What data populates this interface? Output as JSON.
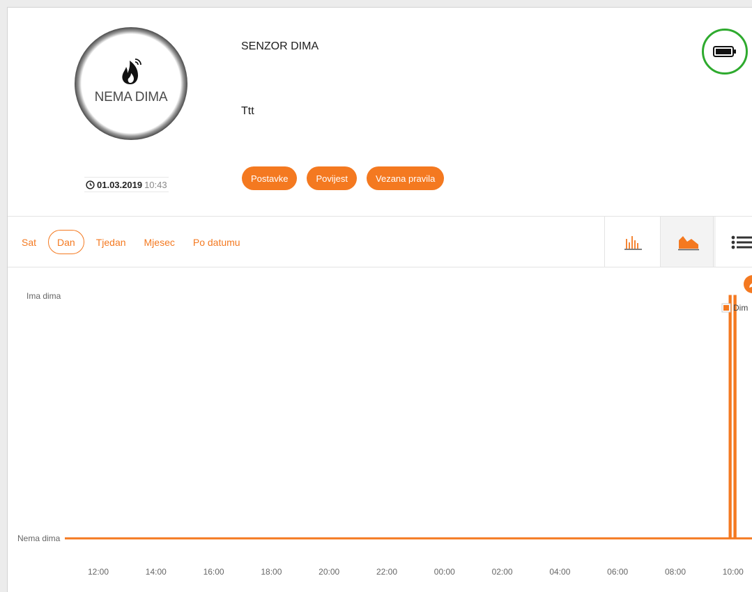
{
  "device": {
    "status_text": "NEMA DIMA",
    "name": "SENZOR DIMA",
    "description": "Ttt",
    "date": "01.03.2019",
    "time": "10:43",
    "battery_status": "full",
    "battery_color": "#2eaa2e"
  },
  "actions": {
    "settings": "Postavke",
    "history": "Povijest",
    "rules": "Vezana pravila"
  },
  "range_tabs": [
    {
      "label": "Sat",
      "active": false
    },
    {
      "label": "Dan",
      "active": true
    },
    {
      "label": "Tjedan",
      "active": false
    },
    {
      "label": "Mjesec",
      "active": false
    },
    {
      "label": "Po datumu",
      "active": false
    }
  ],
  "view_modes": {
    "options": [
      "bar-chart-icon",
      "area-chart-icon",
      "list-icon"
    ],
    "selected": "area-chart-icon"
  },
  "theme": {
    "accent": "#f47920",
    "axis_text": "#666666"
  },
  "chart_data": {
    "type": "area",
    "y_categories": [
      "Nema dima",
      "Ima dima"
    ],
    "x_ticks": [
      "12:00",
      "14:00",
      "16:00",
      "18:00",
      "20:00",
      "22:00",
      "00:00",
      "02:00",
      "04:00",
      "06:00",
      "08:00",
      "10:00"
    ],
    "series": [
      {
        "name": "Dim",
        "color": "#f47920",
        "points": [
          {
            "x": "10:48",
            "y": 0
          },
          {
            "x": "11:00",
            "y": 0
          },
          {
            "x": "09:53",
            "y": 0
          },
          {
            "x": "09:53",
            "y": 1
          },
          {
            "x": "09:55",
            "y": 1
          },
          {
            "x": "09:55",
            "y": 0
          },
          {
            "x": "10:03",
            "y": 0
          },
          {
            "x": "10:03",
            "y": 1
          },
          {
            "x": "10:05",
            "y": 1
          },
          {
            "x": "10:05",
            "y": 0
          },
          {
            "x": "10:43",
            "y": 0
          }
        ]
      }
    ],
    "legend": "top-right",
    "grid": false
  }
}
